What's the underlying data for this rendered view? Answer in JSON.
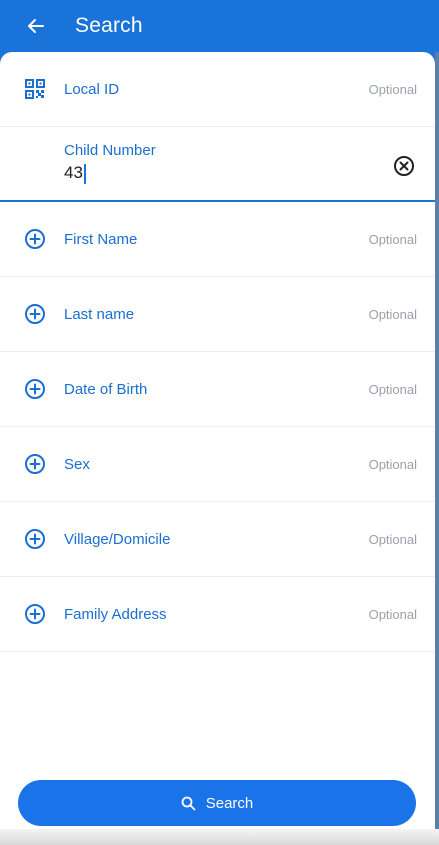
{
  "header": {
    "title": "Search"
  },
  "fields": [
    {
      "label": "Local ID",
      "hint": "Optional",
      "icon": "qr-code-icon"
    },
    {
      "label": "First Name",
      "hint": "Optional",
      "icon": "plus-circle-icon"
    },
    {
      "label": "Last name",
      "hint": "Optional",
      "icon": "plus-circle-icon"
    },
    {
      "label": "Date of Birth",
      "hint": "Optional",
      "icon": "plus-circle-icon"
    },
    {
      "label": "Sex",
      "hint": "Optional",
      "icon": "plus-circle-icon"
    },
    {
      "label": "Village/Domicile",
      "hint": "Optional",
      "icon": "plus-circle-icon"
    },
    {
      "label": "Family Address",
      "hint": "Optional",
      "icon": "plus-circle-icon"
    }
  ],
  "active_field": {
    "label": "Child Number",
    "value": "43"
  },
  "search_button": {
    "label": "Search"
  },
  "colors": {
    "primary": "#1a73d9",
    "label": "#1a6fd1",
    "hint": "#9aa1a9"
  }
}
